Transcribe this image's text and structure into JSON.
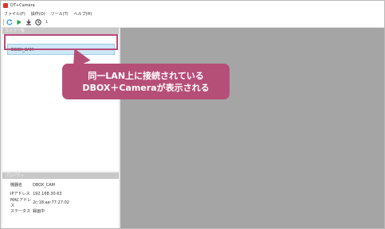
{
  "window": {
    "title": "DT+Camera"
  },
  "menu": [
    "ファイル(F)",
    "操作(O)",
    "ツール(T)",
    "ヘルプ(H)"
  ],
  "toolbar": {
    "icons": [
      "refresh-icon",
      "play-icon",
      "download-icon",
      "clock-icon"
    ],
    "small_label": "1"
  },
  "camera_panel": {
    "header": "カメラ一覧",
    "items": [
      "DBOX_CAM"
    ]
  },
  "properties_panel": {
    "header": "プロパティ",
    "rows": [
      {
        "key": "機器名",
        "value": "DBOX_CAM"
      },
      {
        "key": "IPアドレス",
        "value": "192.168.30.63"
      },
      {
        "key": "MACアドレス",
        "value": "2c:18:ae:77:27:02"
      },
      {
        "key": "ステータス",
        "value": "録画中"
      }
    ]
  },
  "callout": {
    "line1": "同一LAN上に接続されている",
    "line2": "DBOX＋Cameraが表示される"
  },
  "colors": {
    "accent": "#b64f78",
    "selection": "#cfe8f7",
    "preview_bg": "#a5a5a5"
  }
}
